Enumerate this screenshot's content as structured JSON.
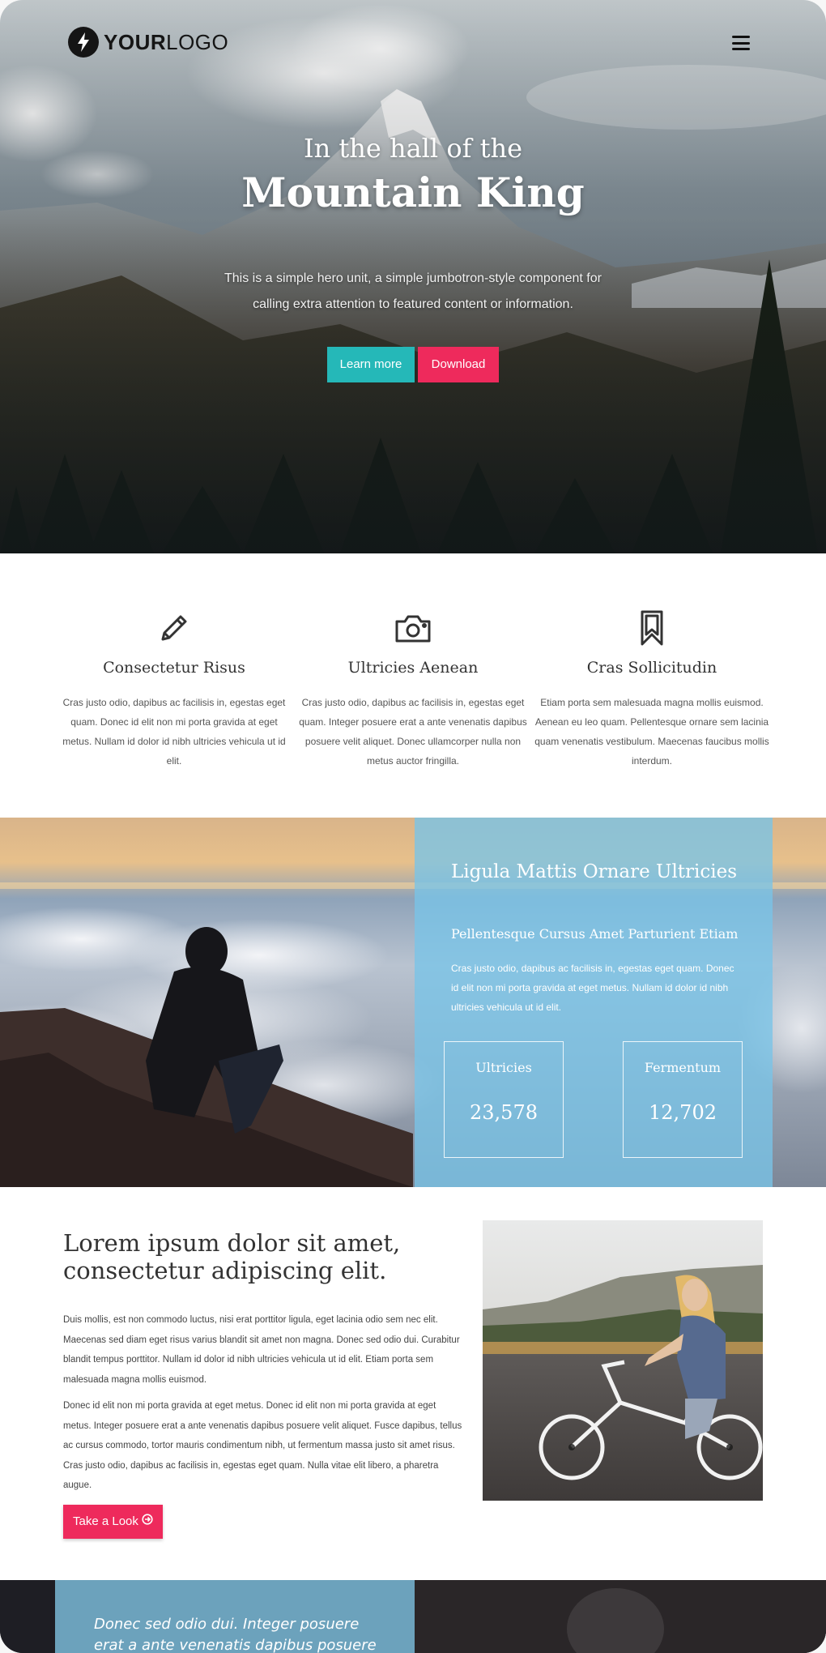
{
  "header": {
    "logo_bold": "YOUR",
    "logo_light": "LOGO",
    "logo_icon": "bolt-icon",
    "menu_icon": "hamburger-menu-icon"
  },
  "hero": {
    "kicker": "In the hall of the",
    "title": "Mountain King",
    "subtitle": "This is a simple hero unit, a simple jumbotron-style component for calling extra attention to featured content or information.",
    "primary_button": "Learn more",
    "secondary_button": "Download"
  },
  "features": [
    {
      "icon": "pencil-icon",
      "title": "Consectetur Risus",
      "text": "Cras justo odio, dapibus ac facilisis in, egestas eget quam. Donec id elit non mi porta gravida at eget metus. Nullam id dolor id nibh ultricies vehicula ut id elit."
    },
    {
      "icon": "camera-icon",
      "title": "Ultricies Aenean",
      "text": "Cras justo odio, dapibus ac facilisis in, egestas eget quam. Integer posuere erat a ante venenatis dapibus posuere velit aliquet. Donec ullamcorper nulla non metus auctor fringilla."
    },
    {
      "icon": "bookmark-icon",
      "title": "Cras Sollicitudin",
      "text": "Etiam porta sem malesuada magna mollis euismod. Aenean eu leo quam. Pellentesque ornare sem lacinia quam venenatis vestibulum. Maecenas faucibus mollis interdum."
    }
  ],
  "stats": {
    "heading": "Ligula Mattis Ornare Ultricies",
    "subheading": "Pellentesque Cursus Amet Parturient Etiam",
    "text": "Cras justo odio, dapibus ac facilisis in, egestas eget quam. Donec id elit non mi porta gravida at eget metus. Nullam id dolor id nibh ultricies vehicula ut id elit.",
    "items": [
      {
        "label": "Ultricies",
        "value": "23,578"
      },
      {
        "label": "Fermentum",
        "value": "12,702"
      }
    ]
  },
  "article": {
    "heading": "Lorem ipsum dolor sit amet, consectetur adipiscing elit.",
    "paragraphs": [
      "Duis mollis, est non commodo luctus, nisi erat porttitor ligula, eget lacinia odio sem nec elit. Maecenas sed diam eget risus varius blandit sit amet non magna. Donec sed odio dui. Curabitur blandit tempus porttitor. Nullam id dolor id nibh ultricies vehicula ut id elit. Etiam porta sem malesuada magna mollis euismod.",
      "Donec id elit non mi porta gravida at eget metus. Donec id elit non mi porta gravida at eget metus. Integer posuere erat a ante venenatis dapibus posuere velit aliquet. Fusce dapibus, tellus ac cursus commodo, tortor mauris condimentum nibh, ut fermentum massa justo sit amet risus. Cras justo odio, dapibus ac facilisis in, egestas eget quam. Nulla vitae elit libero, a pharetra augue."
    ],
    "cta_label": "Take a Look",
    "cta_icon": "arrow-circle-right-icon"
  },
  "strip": {
    "quote": "Donec sed odio dui. Integer posuere erat a ante venenatis dapibus posuere velit"
  }
}
